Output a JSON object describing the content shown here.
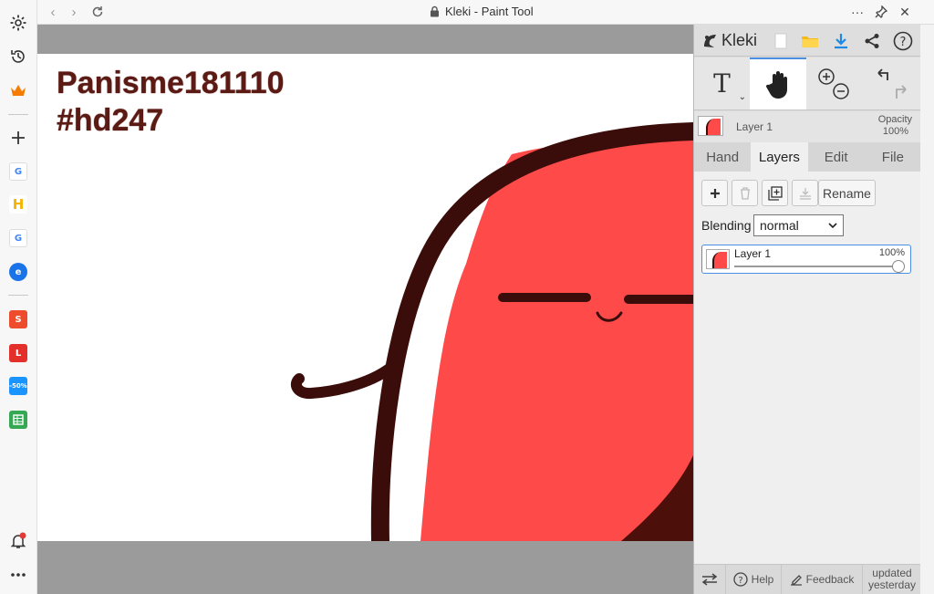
{
  "browser": {
    "page_title": "Kleki - Paint Tool",
    "icons": [
      "settings-icon",
      "history-icon",
      "crown-icon",
      "add-icon",
      "notification-icon",
      "more-icon"
    ]
  },
  "favorites": [
    {
      "name": "google",
      "letter": "G",
      "color": "#ffffff",
      "fg": "#4285f4"
    },
    {
      "name": "h-app",
      "letter": "H",
      "color": "#ffffff",
      "fg": "#f4b400"
    },
    {
      "name": "google-2",
      "letter": "G",
      "color": "#ffffff",
      "fg": "#4285f4"
    },
    {
      "name": "e-app",
      "letter": "e",
      "color": "#1a73e8",
      "fg": "#ffffff"
    },
    {
      "name": "shopee",
      "letter": "S",
      "color": "#ee4d2d",
      "fg": "#ffffff"
    },
    {
      "name": "lazada",
      "letter": "L",
      "color": "#e4302b",
      "fg": "#ffffff"
    },
    {
      "name": "tiki",
      "letter": "-50%",
      "color": "#1a94ff",
      "fg": "#ffffff"
    },
    {
      "name": "sheets",
      "letter": "",
      "color": "#34a853",
      "fg": "#ffffff"
    }
  ],
  "canvas": {
    "line1": "Panisme181110",
    "line2": "#hd247"
  },
  "panel": {
    "logo": "Kleki",
    "layer_name": "Layer 1",
    "opacity_label": "Opacity",
    "opacity_value": "100%",
    "tabs": [
      "Hand",
      "Layers",
      "Edit",
      "File"
    ],
    "active_tab": "Layers",
    "rename_label": "Rename",
    "blending_label": "Blending",
    "blending_value": "normal",
    "layers": [
      {
        "name": "Layer 1",
        "opacity": "100%"
      }
    ],
    "bottom": {
      "help": "Help",
      "feedback": "Feedback",
      "updated_line1": "updated",
      "updated_line2": "yesterday"
    }
  },
  "colors": {
    "accent": "#4a90e2",
    "character_red": "#ff4a4a",
    "outline": "#3a0d0a",
    "text_brown": "#5b1a14"
  }
}
